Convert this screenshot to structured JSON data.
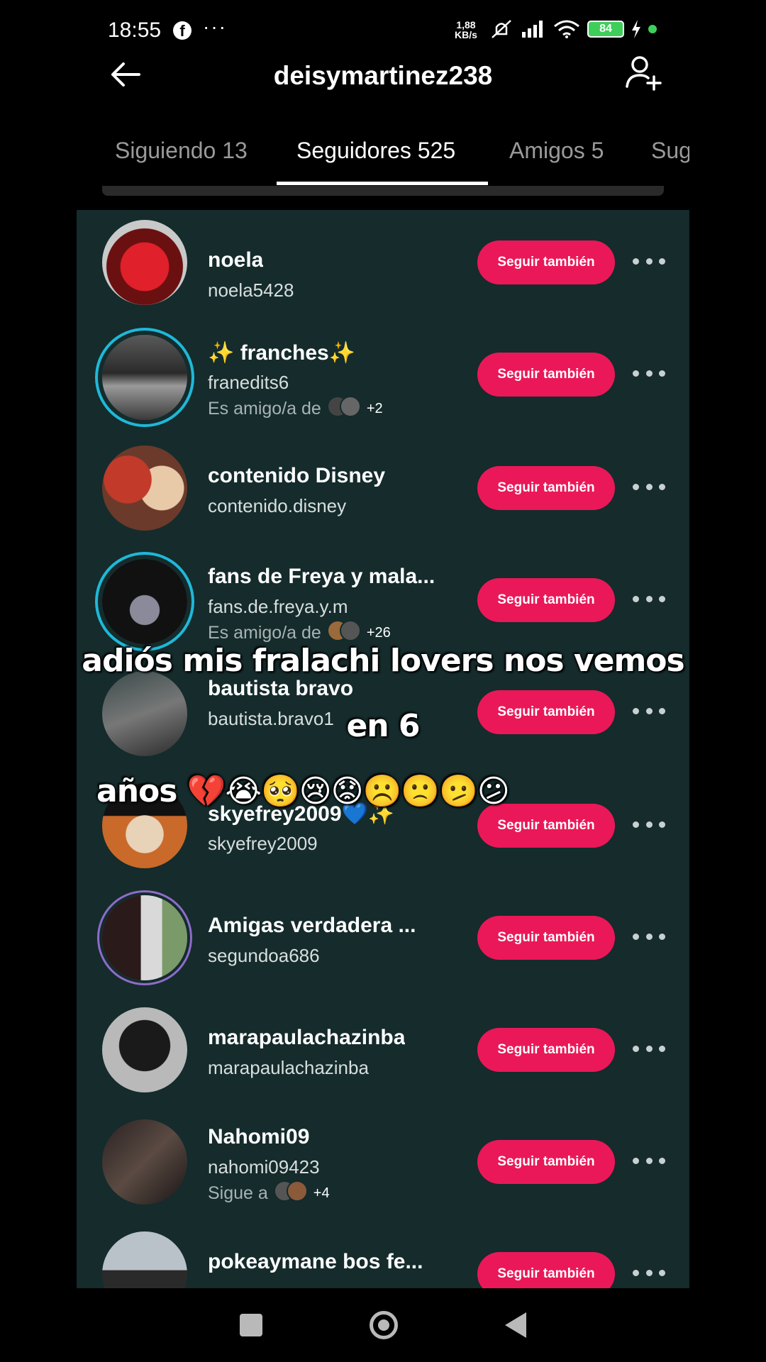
{
  "status_bar": {
    "time": "18:55",
    "speed_value": "1,88",
    "speed_unit": "KB/s",
    "battery": "84"
  },
  "header": {
    "title": "deisymartinez238"
  },
  "tabs": [
    {
      "label": "Siguiendo 13",
      "active": false
    },
    {
      "label": "Seguidores 525",
      "active": true
    },
    {
      "label": "Amigos 5",
      "active": false
    },
    {
      "label": "Sug",
      "active": false
    }
  ],
  "followers": [
    {
      "name": "noela",
      "handle": "noela5428",
      "sub": "",
      "button": "Seguir también"
    },
    {
      "name": "✨ franches✨",
      "handle": "franedits6",
      "sub": "Es amigo/a de",
      "sub_count": "+2",
      "button": "Seguir también"
    },
    {
      "name": "contenido Disney",
      "handle": "contenido.disney",
      "sub": "",
      "button": "Seguir también"
    },
    {
      "name": "fans de Freya y mala...",
      "handle": "fans.de.freya.y.m",
      "sub": "Es amigo/a de",
      "sub_count": "+26",
      "button": "Seguir también"
    },
    {
      "name": "bautista bravo",
      "handle": "bautista.bravo1",
      "sub": "",
      "button": "Seguir también"
    },
    {
      "name": "skyefrey2009💙✨",
      "handle": "skyefrey2009",
      "sub": "",
      "button": "Seguir también"
    },
    {
      "name": "Amigas verdadera ...",
      "handle": "segundoa686",
      "sub": "",
      "button": "Seguir también"
    },
    {
      "name": "marapaulachazinba",
      "handle": "marapaulachazinba",
      "sub": "",
      "button": "Seguir también"
    },
    {
      "name": "Nahomi09",
      "handle": "nahomi09423",
      "sub": "Sigue a",
      "sub_count": "+4",
      "button": "Seguir también"
    },
    {
      "name": "pokeaymane bos fe...",
      "handle": "",
      "sub": "",
      "button": "Seguir también"
    }
  ],
  "caption": {
    "line1": "adiós mis fralachi lovers nos vemos en 6",
    "line2": "años 💔😭🥺😢😟☹️🙁🫤😕"
  },
  "colors": {
    "accent": "#ea1858",
    "list_bg": "#152b2c",
    "story_ring": "#1fb8d8"
  }
}
